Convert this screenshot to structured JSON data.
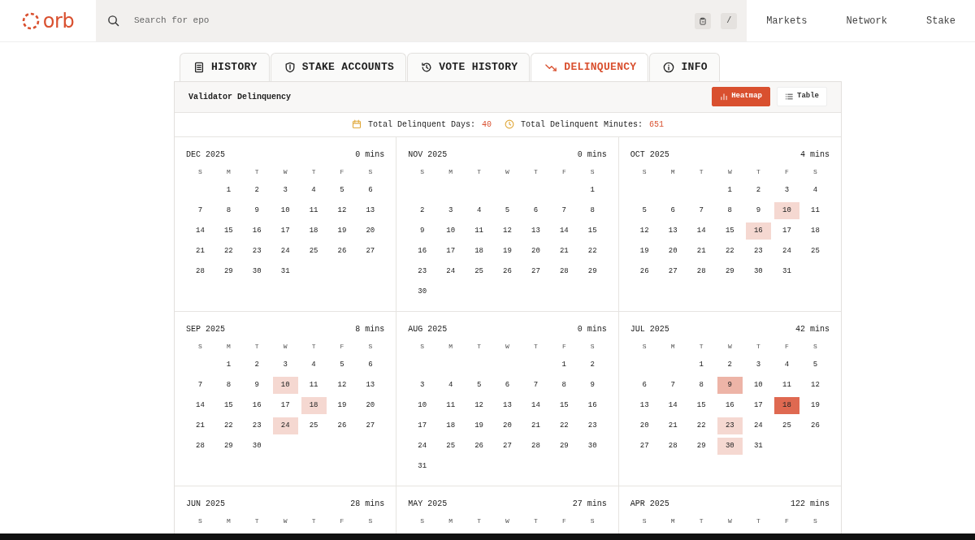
{
  "logo": {
    "text": "orb"
  },
  "search": {
    "placeholder": "Search for epo",
    "shortcut": "/"
  },
  "nav": [
    {
      "label": "Markets"
    },
    {
      "label": "Network"
    },
    {
      "label": "Stake"
    }
  ],
  "tabs": [
    {
      "label": "HISTORY",
      "kind": "document",
      "selected": false
    },
    {
      "label": "STAKE ACCOUNTS",
      "kind": "shield",
      "selected": false
    },
    {
      "label": "VOTE HISTORY",
      "kind": "history",
      "selected": false
    },
    {
      "label": "DELINQUENCY",
      "kind": "trend",
      "selected": true
    },
    {
      "label": "INFO",
      "kind": "info",
      "selected": false
    }
  ],
  "panel": {
    "title": "Validator Delinquency",
    "views": [
      {
        "label": "Heatmap",
        "kind": "chart",
        "selected": true
      },
      {
        "label": "Table",
        "kind": "list",
        "selected": false
      }
    ],
    "summary": [
      {
        "kind": "calendar",
        "label": "Total Delinquent Days:",
        "value": "40"
      },
      {
        "kind": "clock",
        "label": "Total Delinquent Minutes:",
        "value": "651"
      }
    ],
    "months": [
      {
        "title": "DEC 2025",
        "total": "0 mins",
        "weekdays": [
          "S",
          "M",
          "T",
          "W",
          "T",
          "F",
          "S"
        ],
        "days": [
          {
            "day": "1",
            "kind": "monday"
          },
          "2",
          "3",
          "4",
          "5",
          "6",
          "7",
          "8",
          "9",
          "10",
          "11",
          "12",
          "13",
          "14",
          "15",
          "16",
          "17",
          "18",
          "19",
          "20",
          "21",
          "22",
          "23",
          "24",
          "25",
          "26",
          "27",
          "28",
          "29",
          "30",
          "31"
        ]
      },
      {
        "title": "NOV 2025",
        "total": "0 mins",
        "weekdays": [
          "S",
          "M",
          "T",
          "W",
          "T",
          "F",
          "S"
        ],
        "days": [
          {
            "day": "1",
            "kind": "saturday"
          },
          "2",
          "3",
          "4",
          "5",
          "6",
          "7",
          "8",
          "9",
          "10",
          "11",
          "12",
          "13",
          "14",
          "15",
          "16",
          "17",
          "18",
          "19",
          "20",
          "21",
          "22",
          "23",
          "24",
          "25",
          "26",
          "27",
          "28",
          "29",
          "30"
        ]
      },
      {
        "title": "OCT 2025",
        "total": "4 mins",
        "weekdays": [
          "S",
          "M",
          "T",
          "W",
          "T",
          "F",
          "S"
        ],
        "days": [
          {
            "day": "1",
            "kind": "wednesday"
          },
          "2",
          "3",
          "4",
          "5",
          "6",
          "7",
          "8",
          "9",
          {
            "day": "10",
            "color": "#f5d8d1"
          },
          "11",
          "12",
          "13",
          "14",
          "15",
          {
            "day": "16",
            "color": "#f5d8d1"
          },
          "17",
          "18",
          "19",
          "20",
          "21",
          "22",
          "23",
          "24",
          "25",
          "26",
          "27",
          "28",
          "29",
          "30",
          "31"
        ]
      },
      {
        "title": "SEP 2025",
        "total": "8 mins",
        "weekdays": [
          "S",
          "M",
          "T",
          "W",
          "T",
          "F",
          "S"
        ],
        "days": [
          {
            "day": "1",
            "kind": "monday"
          },
          "2",
          "3",
          "4",
          "5",
          "6",
          "7",
          "8",
          "9",
          {
            "day": "10",
            "color": "#f5d8d1"
          },
          "11",
          "12",
          "13",
          "14",
          "15",
          "16",
          "17",
          {
            "day": "18",
            "color": "#f5d8d1"
          },
          "19",
          "20",
          "21",
          "22",
          "23",
          {
            "day": "24",
            "color": "#f5d8d1"
          },
          "25",
          "26",
          "27",
          "28",
          "29",
          "30"
        ]
      },
      {
        "title": "AUG 2025",
        "total": "0 mins",
        "weekdays": [
          "S",
          "M",
          "T",
          "W",
          "T",
          "F",
          "S"
        ],
        "days": [
          {
            "day": "1",
            "kind": "friday"
          },
          "2",
          "3",
          "4",
          "5",
          "6",
          "7",
          "8",
          "9",
          "10",
          "11",
          "12",
          "13",
          "14",
          "15",
          "16",
          "17",
          "18",
          "19",
          "20",
          "21",
          "22",
          "23",
          "24",
          "25",
          "26",
          "27",
          "28",
          "29",
          "30",
          "31"
        ]
      },
      {
        "title": "JUL 2025",
        "total": "42 mins",
        "weekdays": [
          "S",
          "M",
          "T",
          "W",
          "T",
          "F",
          "S"
        ],
        "days": [
          {
            "day": "1",
            "kind": "tuesday"
          },
          "2",
          "3",
          "4",
          "5",
          "6",
          "7",
          "8",
          {
            "day": "9",
            "color": "#edb4a7"
          },
          "10",
          "11",
          "12",
          "13",
          "14",
          "15",
          "16",
          "17",
          {
            "day": "18",
            "color": "#df6951"
          },
          "19",
          "20",
          "21",
          "22",
          {
            "day": "23",
            "color": "#f5d8d1"
          },
          "24",
          "25",
          "26",
          "27",
          "28",
          "29",
          {
            "day": "30",
            "color": "#f5d8d1"
          },
          "31"
        ]
      },
      {
        "title": "JUN 2025",
        "total": "28 mins",
        "weekdays": [
          "S",
          "M",
          "T",
          "W",
          "T",
          "F",
          "S"
        ]
      },
      {
        "title": "MAY 2025",
        "total": "27 mins",
        "weekdays": [
          "S",
          "M",
          "T",
          "W",
          "T",
          "F",
          "S"
        ]
      },
      {
        "title": "APR 2025",
        "total": "122 mins",
        "weekdays": [
          "S",
          "M",
          "T",
          "W",
          "T",
          "F",
          "S"
        ]
      }
    ]
  }
}
